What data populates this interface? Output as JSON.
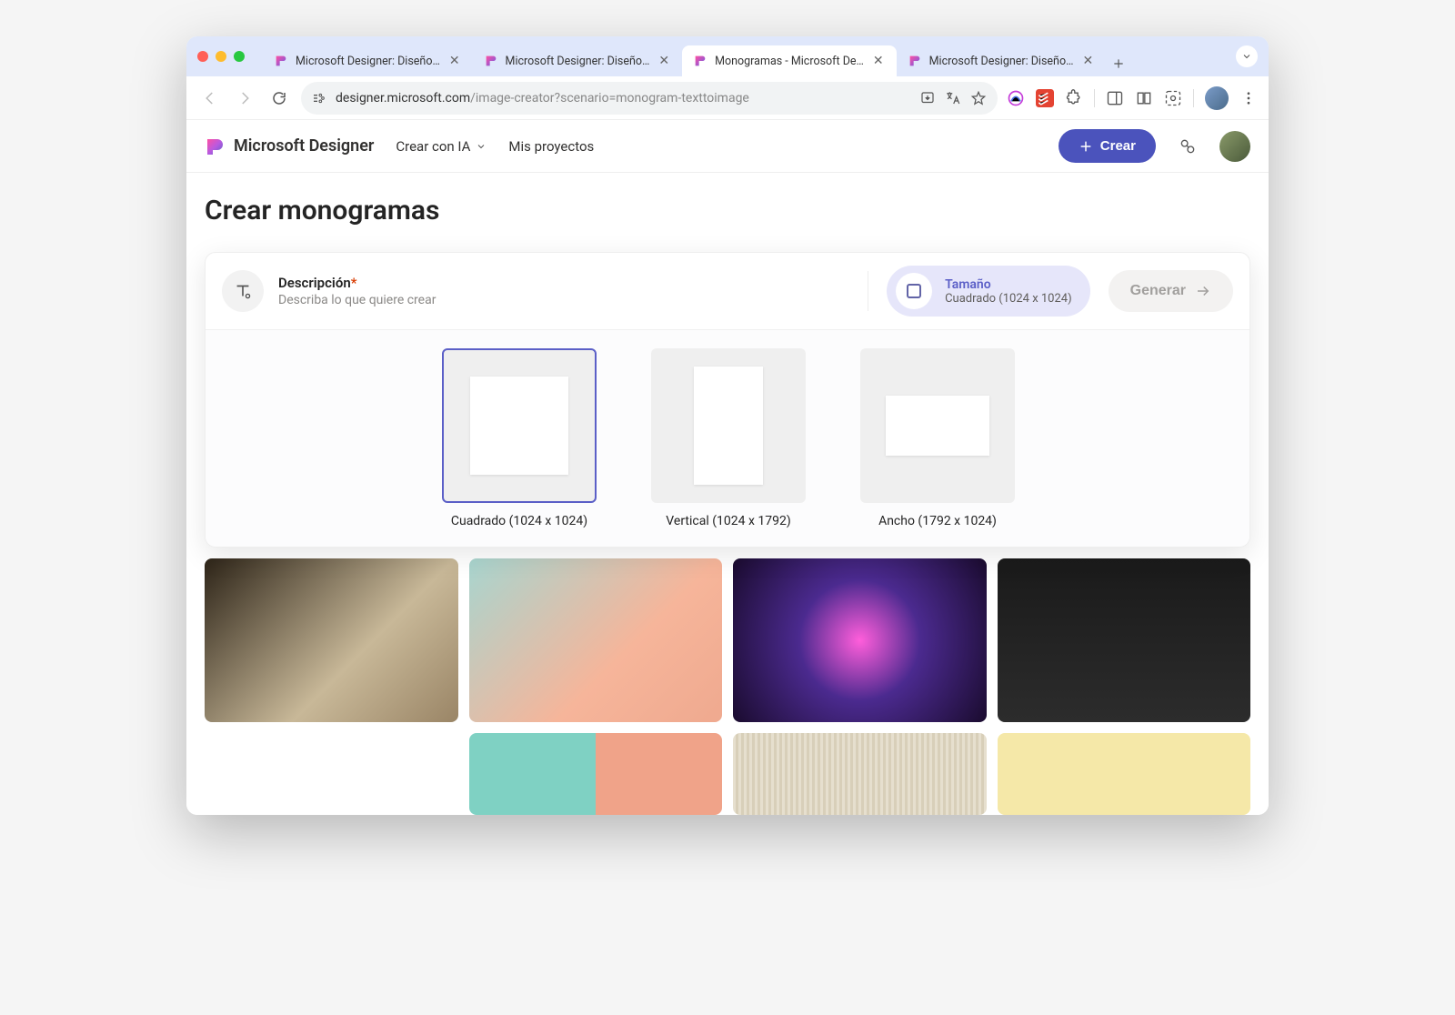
{
  "browser": {
    "tabs": [
      {
        "title": "Microsoft Designer: Diseño…",
        "active": false
      },
      {
        "title": "Microsoft Designer: Diseño…",
        "active": false
      },
      {
        "title": "Monogramas - Microsoft De…",
        "active": true
      },
      {
        "title": "Microsoft Designer: Diseño…",
        "active": false
      }
    ],
    "url_host": "designer.microsoft.com",
    "url_path": "/image-creator?scenario=monogram-texttoimage"
  },
  "app_header": {
    "brand": "Microsoft Designer",
    "nav_create_ai": "Crear con IA",
    "nav_projects": "Mis proyectos",
    "crear_button": "Crear"
  },
  "page": {
    "title": "Crear monogramas",
    "description_label": "Descripción",
    "description_required": "*",
    "description_hint": "Describa lo que quiere crear",
    "size_label": "Tamaño",
    "size_current": "Cuadrado (1024 x 1024)",
    "generate_label": "Generar",
    "size_options": [
      {
        "id": "square",
        "label": "Cuadrado (1024 x 1024)",
        "selected": true
      },
      {
        "id": "vertical",
        "label": "Vertical (1024 x 1792)",
        "selected": false
      },
      {
        "id": "wide",
        "label": "Ancho (1792 x 1024)",
        "selected": false
      }
    ]
  }
}
